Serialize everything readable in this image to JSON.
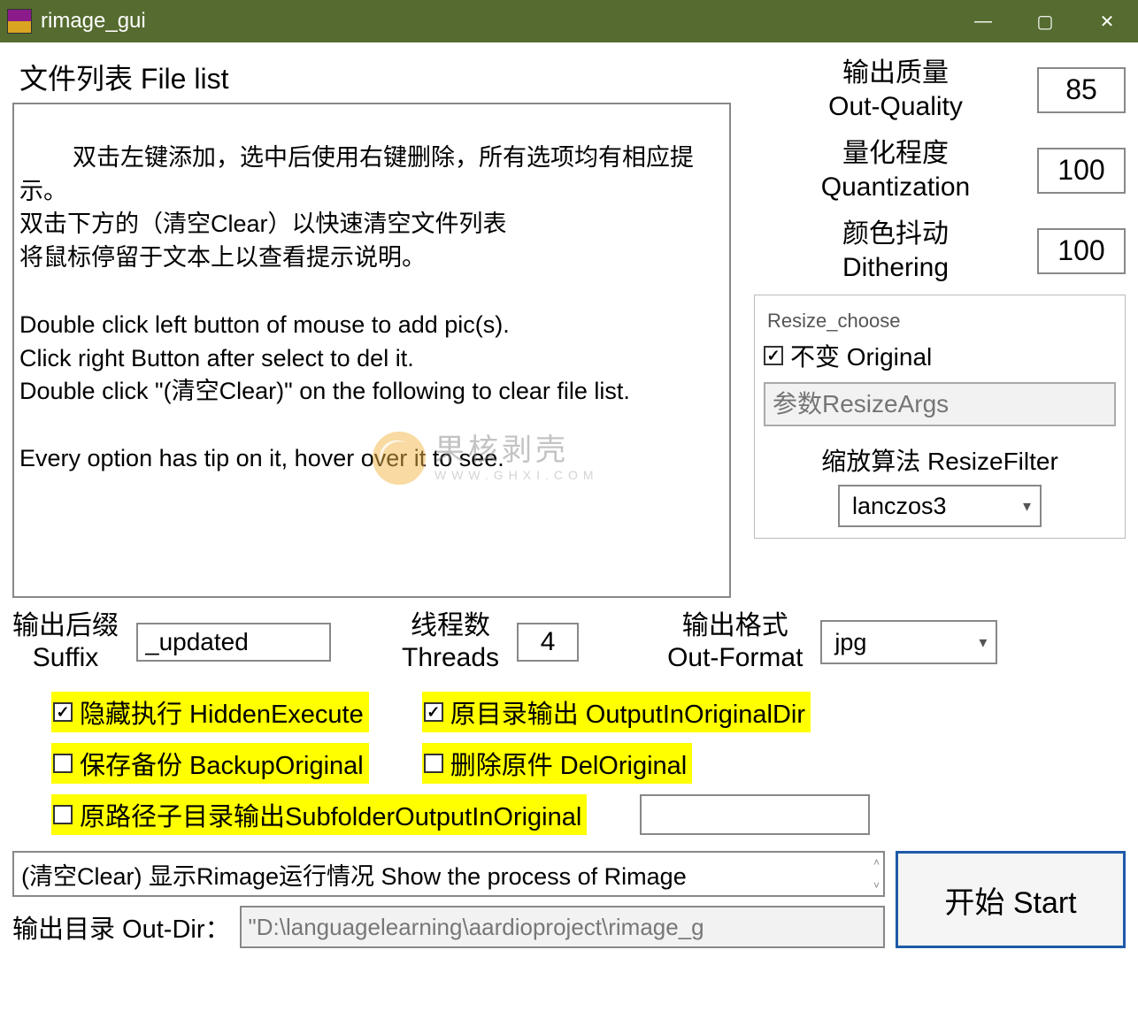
{
  "window": {
    "title": "rimage_gui"
  },
  "file_list": {
    "title": "文件列表 File list",
    "text": "双击左键添加，选中后使用右键删除，所有选项均有相应提示。\n双击下方的（清空Clear）以快速清空文件列表\n将鼠标停留于文本上以查看提示说明。\n\nDouble click left button of mouse to add pic(s).\nClick right Button after select to del it.\nDouble click \"(清空Clear)\" on the following to clear file list.\n\nEvery option has tip on it, hover over it to see."
  },
  "watermark": {
    "cn": "果核剥壳",
    "en": "WWW.GHXI.COM"
  },
  "params": {
    "out_quality": {
      "label": "输出质量\nOut-Quality",
      "value": "85"
    },
    "quantization": {
      "label": "量化程度\nQuantization",
      "value": "100"
    },
    "dithering": {
      "label": "颜色抖动\nDithering",
      "value": "100"
    }
  },
  "resize": {
    "legend": "Resize_choose",
    "original_label": "不变 Original",
    "original_checked": true,
    "args_placeholder": "参数ResizeArgs",
    "filter_label": "缩放算法 ResizeFilter",
    "filter_value": "lanczos3"
  },
  "suffix": {
    "label": "输出后缀\nSuffix",
    "value": "_updated"
  },
  "threads": {
    "label": "线程数\nThreads",
    "value": "4"
  },
  "out_format": {
    "label": "输出格式\nOut-Format",
    "value": "jpg"
  },
  "checks": {
    "hidden_execute": {
      "label": "隐藏执行 HiddenExecute",
      "checked": true
    },
    "output_in_original_dir": {
      "label": "原目录输出 OutputInOriginalDir",
      "checked": true
    },
    "backup_original": {
      "label": "保存备份 BackupOriginal",
      "checked": false
    },
    "del_original": {
      "label": "删除原件 DelOriginal",
      "checked": false
    },
    "subfolder_output": {
      "label": "原路径子目录输出SubfolderOutputInOriginal",
      "checked": false
    }
  },
  "status": "(清空Clear) 显示Rimage运行情况 Show the process of Rimage",
  "out_dir": {
    "label": "输出目录 Out-Dir：",
    "value": "\"D:\\languagelearning\\aardioproject\\rimage_g"
  },
  "start_label": "开始 Start"
}
